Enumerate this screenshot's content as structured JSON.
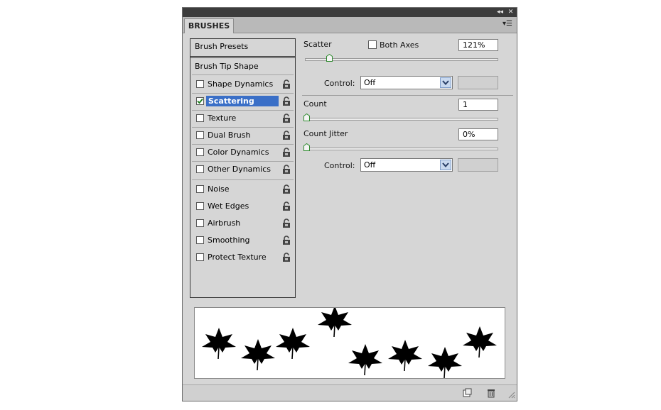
{
  "panel": {
    "tab_label": "BRUSHES",
    "titlebar_icons": [
      "collapse-icon",
      "close-icon"
    ],
    "menu_icon": "panel-menu-icon"
  },
  "left": {
    "presets_label": "Brush Presets",
    "tip_shape_label": "Brush Tip Shape",
    "items": [
      {
        "label": "Shape Dynamics",
        "checked": false
      },
      {
        "label": "Scattering",
        "checked": true,
        "selected": true
      },
      {
        "label": "Texture",
        "checked": false
      },
      {
        "label": "Dual Brush",
        "checked": false
      },
      {
        "label": "Color Dynamics",
        "checked": false
      },
      {
        "label": "Other Dynamics",
        "checked": false
      },
      {
        "label": "Noise",
        "checked": false
      },
      {
        "label": "Wet Edges",
        "checked": false
      },
      {
        "label": "Airbrush",
        "checked": false
      },
      {
        "label": "Smoothing",
        "checked": false
      },
      {
        "label": "Protect Texture",
        "checked": false
      }
    ]
  },
  "scatter": {
    "label": "Scatter",
    "both_axes_label": "Both Axes",
    "both_axes_checked": false,
    "value": "121%",
    "slider_fraction": 0.121,
    "control_label": "Control:",
    "control_value": "Off"
  },
  "count": {
    "label": "Count",
    "value": "1",
    "slider_fraction": 0.0
  },
  "count_jitter": {
    "label": "Count Jitter",
    "value": "0%",
    "slider_fraction": 0.0,
    "control_label": "Control:",
    "control_value": "Off"
  },
  "preview": {
    "stamp_count": 8
  },
  "bottom": {
    "icons": [
      "new-brush-icon",
      "trash-icon",
      "resize-grip-icon"
    ]
  },
  "colors": {
    "selection": "#3a6fc7",
    "panel_bg": "#d6d6d6",
    "titlebar": "#3c3c3c"
  }
}
